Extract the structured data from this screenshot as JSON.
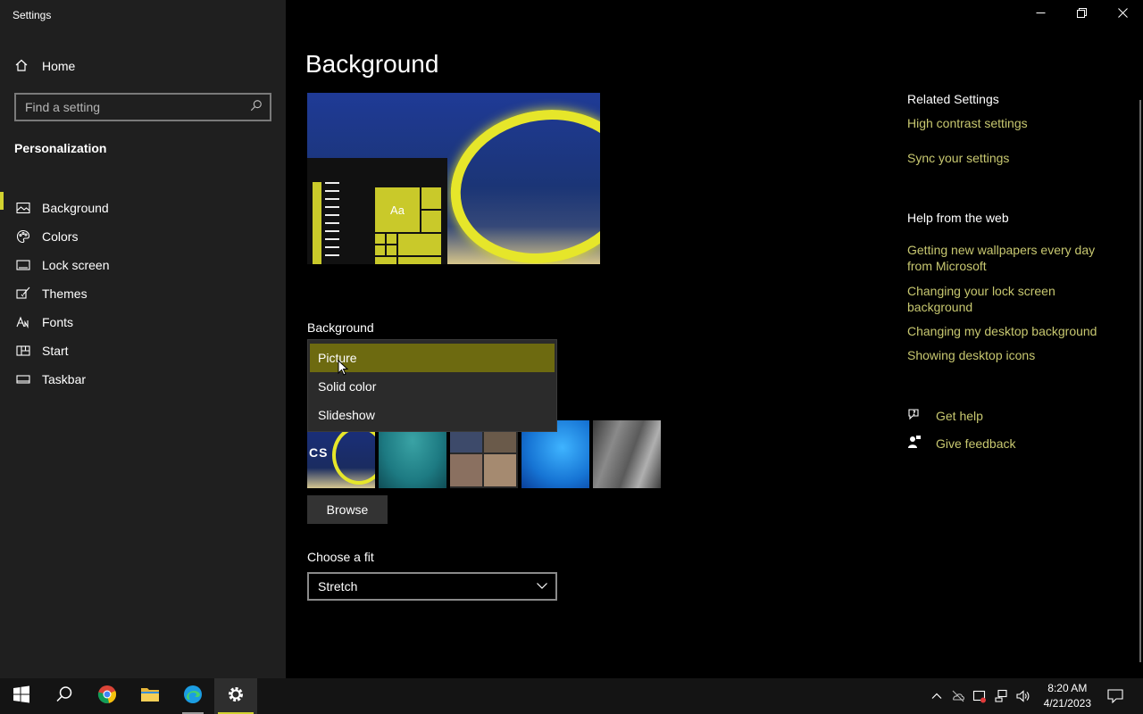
{
  "window": {
    "title": "Settings"
  },
  "sidebar": {
    "home_label": "Home",
    "search_placeholder": "Find a setting",
    "section_title": "Personalization",
    "items": [
      {
        "label": "Background",
        "icon": "picture-icon",
        "active": true
      },
      {
        "label": "Colors",
        "icon": "palette-icon"
      },
      {
        "label": "Lock screen",
        "icon": "lock-screen-icon"
      },
      {
        "label": "Themes",
        "icon": "brush-icon"
      },
      {
        "label": "Fonts",
        "icon": "font-icon"
      },
      {
        "label": "Start",
        "icon": "start-grid-icon"
      },
      {
        "label": "Taskbar",
        "icon": "taskbar-icon"
      }
    ]
  },
  "main": {
    "page_title": "Background",
    "preview": {
      "tile_text": "Aa"
    },
    "background_label": "Background",
    "background_options": [
      "Picture",
      "Solid color",
      "Slideshow"
    ],
    "background_selected": "Picture",
    "thumb_caption": "CS",
    "browse_label": "Browse",
    "fit_label": "Choose a fit",
    "fit_value": "Stretch"
  },
  "related": {
    "heading": "Related Settings",
    "links": [
      "High contrast settings",
      "Sync your settings"
    ],
    "help_heading": "Help from the web",
    "help_links": [
      "Getting new wallpapers every day from Microsoft",
      "Changing your lock screen background",
      "Changing my desktop background",
      "Showing desktop icons"
    ],
    "get_help": "Get help",
    "give_feedback": "Give feedback"
  },
  "taskbar": {
    "time": "8:20 AM",
    "date": "4/21/2023"
  },
  "colors": {
    "accent": "#d2d230",
    "link": "#c8c870",
    "sidebar_bg": "#1f1f1f"
  }
}
